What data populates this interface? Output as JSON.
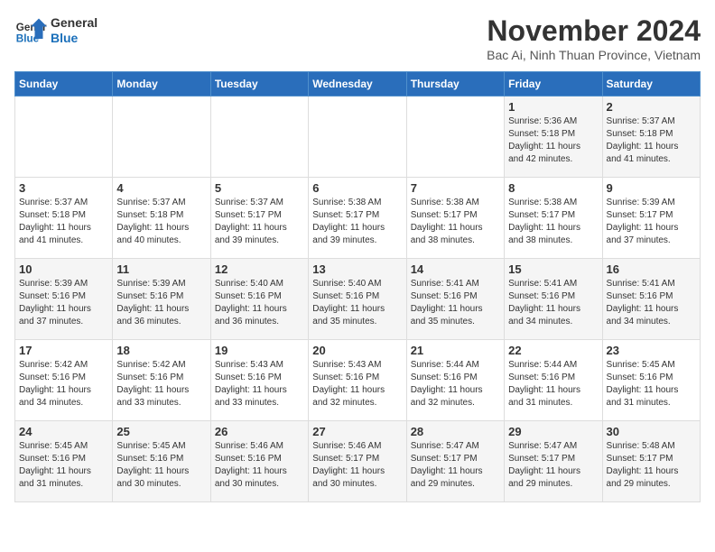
{
  "logo": {
    "line1": "General",
    "line2": "Blue"
  },
  "title": "November 2024",
  "subtitle": "Bac Ai, Ninh Thuan Province, Vietnam",
  "headers": [
    "Sunday",
    "Monday",
    "Tuesday",
    "Wednesday",
    "Thursday",
    "Friday",
    "Saturday"
  ],
  "weeks": [
    [
      {
        "day": "",
        "info": ""
      },
      {
        "day": "",
        "info": ""
      },
      {
        "day": "",
        "info": ""
      },
      {
        "day": "",
        "info": ""
      },
      {
        "day": "",
        "info": ""
      },
      {
        "day": "1",
        "info": "Sunrise: 5:36 AM\nSunset: 5:18 PM\nDaylight: 11 hours\nand 42 minutes."
      },
      {
        "day": "2",
        "info": "Sunrise: 5:37 AM\nSunset: 5:18 PM\nDaylight: 11 hours\nand 41 minutes."
      }
    ],
    [
      {
        "day": "3",
        "info": "Sunrise: 5:37 AM\nSunset: 5:18 PM\nDaylight: 11 hours\nand 41 minutes."
      },
      {
        "day": "4",
        "info": "Sunrise: 5:37 AM\nSunset: 5:18 PM\nDaylight: 11 hours\nand 40 minutes."
      },
      {
        "day": "5",
        "info": "Sunrise: 5:37 AM\nSunset: 5:17 PM\nDaylight: 11 hours\nand 39 minutes."
      },
      {
        "day": "6",
        "info": "Sunrise: 5:38 AM\nSunset: 5:17 PM\nDaylight: 11 hours\nand 39 minutes."
      },
      {
        "day": "7",
        "info": "Sunrise: 5:38 AM\nSunset: 5:17 PM\nDaylight: 11 hours\nand 38 minutes."
      },
      {
        "day": "8",
        "info": "Sunrise: 5:38 AM\nSunset: 5:17 PM\nDaylight: 11 hours\nand 38 minutes."
      },
      {
        "day": "9",
        "info": "Sunrise: 5:39 AM\nSunset: 5:17 PM\nDaylight: 11 hours\nand 37 minutes."
      }
    ],
    [
      {
        "day": "10",
        "info": "Sunrise: 5:39 AM\nSunset: 5:16 PM\nDaylight: 11 hours\nand 37 minutes."
      },
      {
        "day": "11",
        "info": "Sunrise: 5:39 AM\nSunset: 5:16 PM\nDaylight: 11 hours\nand 36 minutes."
      },
      {
        "day": "12",
        "info": "Sunrise: 5:40 AM\nSunset: 5:16 PM\nDaylight: 11 hours\nand 36 minutes."
      },
      {
        "day": "13",
        "info": "Sunrise: 5:40 AM\nSunset: 5:16 PM\nDaylight: 11 hours\nand 35 minutes."
      },
      {
        "day": "14",
        "info": "Sunrise: 5:41 AM\nSunset: 5:16 PM\nDaylight: 11 hours\nand 35 minutes."
      },
      {
        "day": "15",
        "info": "Sunrise: 5:41 AM\nSunset: 5:16 PM\nDaylight: 11 hours\nand 34 minutes."
      },
      {
        "day": "16",
        "info": "Sunrise: 5:41 AM\nSunset: 5:16 PM\nDaylight: 11 hours\nand 34 minutes."
      }
    ],
    [
      {
        "day": "17",
        "info": "Sunrise: 5:42 AM\nSunset: 5:16 PM\nDaylight: 11 hours\nand 34 minutes."
      },
      {
        "day": "18",
        "info": "Sunrise: 5:42 AM\nSunset: 5:16 PM\nDaylight: 11 hours\nand 33 minutes."
      },
      {
        "day": "19",
        "info": "Sunrise: 5:43 AM\nSunset: 5:16 PM\nDaylight: 11 hours\nand 33 minutes."
      },
      {
        "day": "20",
        "info": "Sunrise: 5:43 AM\nSunset: 5:16 PM\nDaylight: 11 hours\nand 32 minutes."
      },
      {
        "day": "21",
        "info": "Sunrise: 5:44 AM\nSunset: 5:16 PM\nDaylight: 11 hours\nand 32 minutes."
      },
      {
        "day": "22",
        "info": "Sunrise: 5:44 AM\nSunset: 5:16 PM\nDaylight: 11 hours\nand 31 minutes."
      },
      {
        "day": "23",
        "info": "Sunrise: 5:45 AM\nSunset: 5:16 PM\nDaylight: 11 hours\nand 31 minutes."
      }
    ],
    [
      {
        "day": "24",
        "info": "Sunrise: 5:45 AM\nSunset: 5:16 PM\nDaylight: 11 hours\nand 31 minutes."
      },
      {
        "day": "25",
        "info": "Sunrise: 5:45 AM\nSunset: 5:16 PM\nDaylight: 11 hours\nand 30 minutes."
      },
      {
        "day": "26",
        "info": "Sunrise: 5:46 AM\nSunset: 5:16 PM\nDaylight: 11 hours\nand 30 minutes."
      },
      {
        "day": "27",
        "info": "Sunrise: 5:46 AM\nSunset: 5:17 PM\nDaylight: 11 hours\nand 30 minutes."
      },
      {
        "day": "28",
        "info": "Sunrise: 5:47 AM\nSunset: 5:17 PM\nDaylight: 11 hours\nand 29 minutes."
      },
      {
        "day": "29",
        "info": "Sunrise: 5:47 AM\nSunset: 5:17 PM\nDaylight: 11 hours\nand 29 minutes."
      },
      {
        "day": "30",
        "info": "Sunrise: 5:48 AM\nSunset: 5:17 PM\nDaylight: 11 hours\nand 29 minutes."
      }
    ]
  ]
}
